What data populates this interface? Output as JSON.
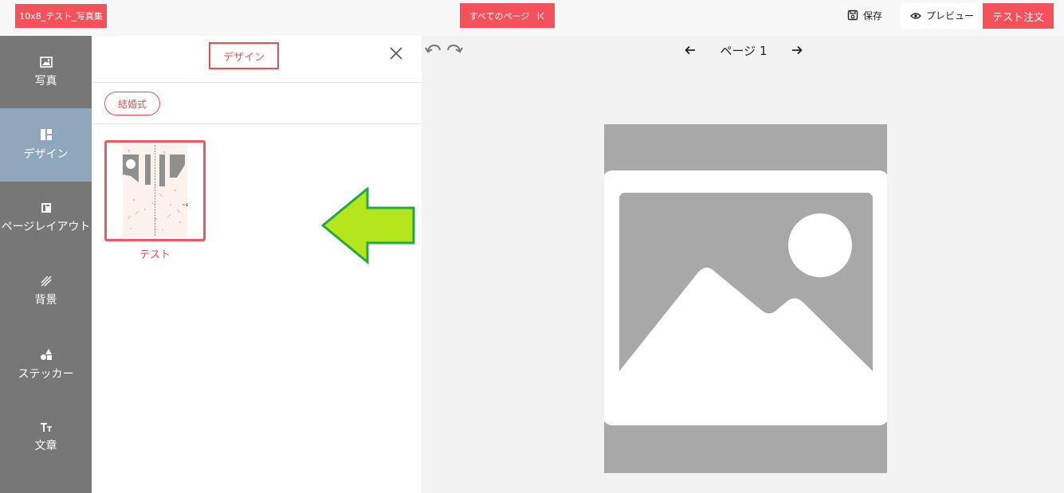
{
  "header": {
    "project_name": "10x8_テスト_写真集",
    "all_pages_label": "すべてのページ",
    "all_pages_icon": "collapse-left-icon",
    "save_label": "保存",
    "preview_label": "プレビュー",
    "order_label": "テスト注文",
    "accent_color": "#f5515a"
  },
  "sidebar": {
    "items": [
      {
        "label": "写真",
        "icon": "image-icon"
      },
      {
        "label": "デザイン",
        "icon": "layout-icon",
        "active": true
      },
      {
        "label": "ページレイアウト",
        "icon": "page-layout-icon"
      },
      {
        "label": "背景",
        "icon": "background-icon"
      },
      {
        "label": "ステッカー",
        "icon": "shapes-icon"
      },
      {
        "label": "文章",
        "icon": "text-icon"
      }
    ]
  },
  "panel": {
    "title": "デザイン",
    "category_chip": "結婚式",
    "design_items": [
      {
        "label": "テスト"
      }
    ]
  },
  "canvas": {
    "page_label": "ページ 1"
  }
}
